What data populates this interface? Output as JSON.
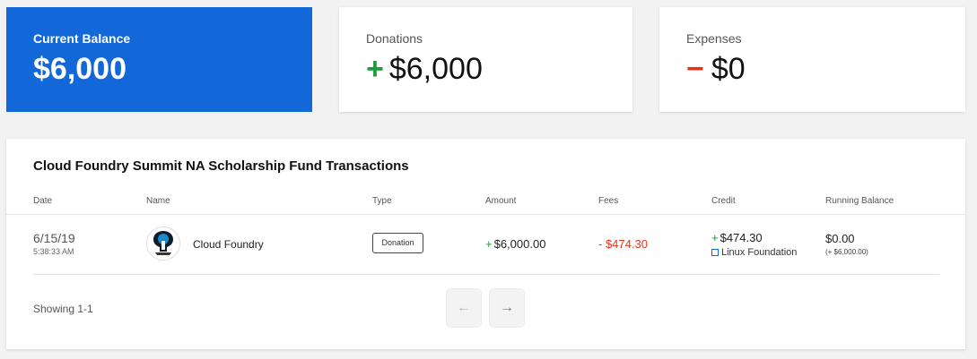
{
  "summary": {
    "balance": {
      "label": "Current Balance",
      "value": "$6,000"
    },
    "donations": {
      "label": "Donations",
      "sign": "+",
      "value": "$6,000"
    },
    "expenses": {
      "label": "Expenses",
      "sign": "−",
      "value": "$0"
    }
  },
  "transactions": {
    "title": "Cloud Foundry Summit NA Scholarship Fund Transactions",
    "columns": [
      "Date",
      "Name",
      "Type",
      "Amount",
      "Fees",
      "Credit",
      "Running Balance"
    ],
    "rows": [
      {
        "date": "6/15/19",
        "time": "5:38:33 AM",
        "name": "Cloud Foundry",
        "type": "Donation",
        "amount_sign": "+",
        "amount": "$6,000.00",
        "fees": "- $474.30",
        "credit_sign": "+",
        "credit": "$474.30",
        "credit_org": "Linux Foundation",
        "running_balance": "$0.00",
        "running_sub": "(+ $6,000.00)"
      }
    ],
    "showing": "Showing 1-1",
    "pager": {
      "prev_icon": "arrow-left-icon",
      "next_icon": "arrow-right-icon",
      "prev": "←",
      "next": "→"
    }
  },
  "colors": {
    "accent": "#1268d9",
    "positive": "#1e9b3a",
    "negative": "#e0341a"
  }
}
